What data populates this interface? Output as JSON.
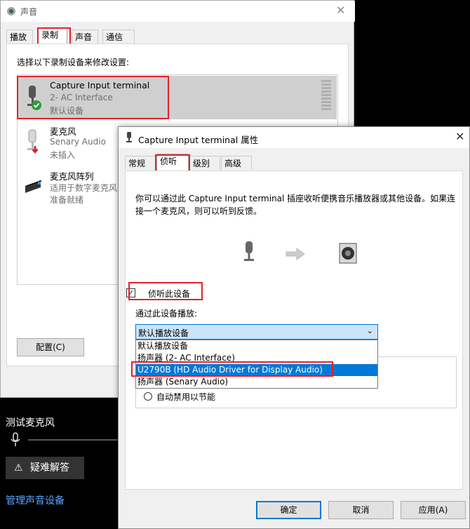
{
  "sound_window": {
    "title": "声音",
    "tabs": [
      "播放",
      "录制",
      "声音",
      "通信"
    ],
    "instruction": "选择以下录制设备来修改设置:",
    "devices": [
      {
        "name": "Capture Input terminal",
        "sub": "2- AC Interface",
        "status": "默认设备"
      },
      {
        "name": "麦克风",
        "sub": "Senary Audio",
        "status": "未插入"
      },
      {
        "name": "麦克风阵列",
        "sub": "适用于数字麦克风",
        "status": "准备就绪"
      }
    ],
    "configure_label": "配置(C)"
  },
  "settings_bg": {
    "test_mic": "测试麦克风",
    "troubleshoot": "疑难解答",
    "manage": "管理声音设备"
  },
  "props": {
    "title": "Capture Input terminal 属性",
    "tabs": [
      "常规",
      "侦听",
      "级别",
      "高级"
    ],
    "description": "你可以通过此 Capture Input terminal 插座收听便携音乐播放器或其他设备。如果连接一个麦克风，则可以听到反馈。",
    "listen_label": "侦听此设备",
    "playback_label": "通过此设备播放:",
    "dropdown_value": "默认播放设备",
    "options": [
      "默认播放设备",
      "扬声器 (2- AC Interface)",
      "U2790B (HD Audio Driver for Display Audio)",
      "扬声器 (Senary Audio)"
    ],
    "auto_disable": "自动禁用以节能",
    "ok": "确定",
    "cancel": "取消",
    "apply": "应用(A)"
  },
  "colors": {
    "accent": "#0078d7",
    "highlight_box": "#e0222a",
    "check_green": "#2e9a3a",
    "unplugged_red": "#d0202a"
  }
}
